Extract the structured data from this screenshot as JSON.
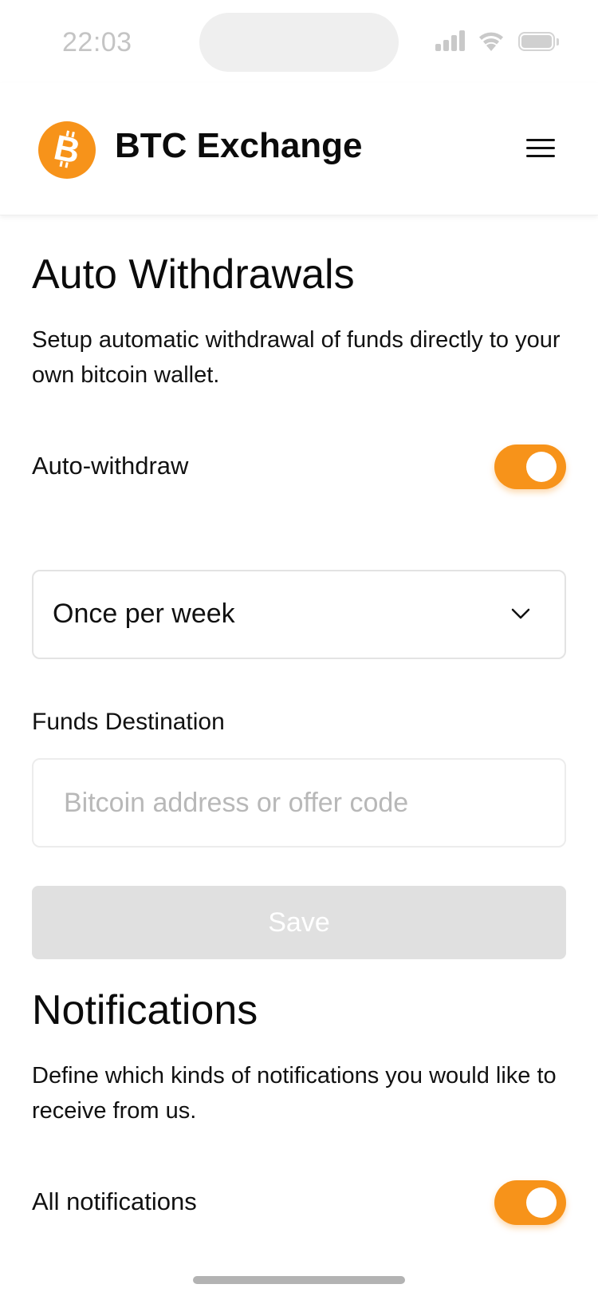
{
  "status_bar": {
    "time": "22:03"
  },
  "header": {
    "title": "BTC Exchange",
    "logo_icon": "bitcoin-logo-icon",
    "menu_icon": "hamburger-menu-icon"
  },
  "auto_withdrawals": {
    "title": "Auto Withdrawals",
    "description": "Setup automatic withdrawal of funds directly to your own bitcoin wallet.",
    "toggle_label": "Auto-withdraw",
    "toggle_on": true,
    "frequency_selected": "Once per week",
    "destination_label": "Funds Destination",
    "destination_value": "",
    "destination_placeholder": "Bitcoin address or offer code",
    "save_label": "Save"
  },
  "notifications": {
    "title": "Notifications",
    "description": "Define which kinds of notifications you would like to receive from us.",
    "toggle_label": "All notifications",
    "toggle_on": true
  },
  "colors": {
    "accent": "#f7931a",
    "disabled_button": "#e0e0e0",
    "text": "#0b0b0b",
    "border": "#e3e3e3"
  }
}
